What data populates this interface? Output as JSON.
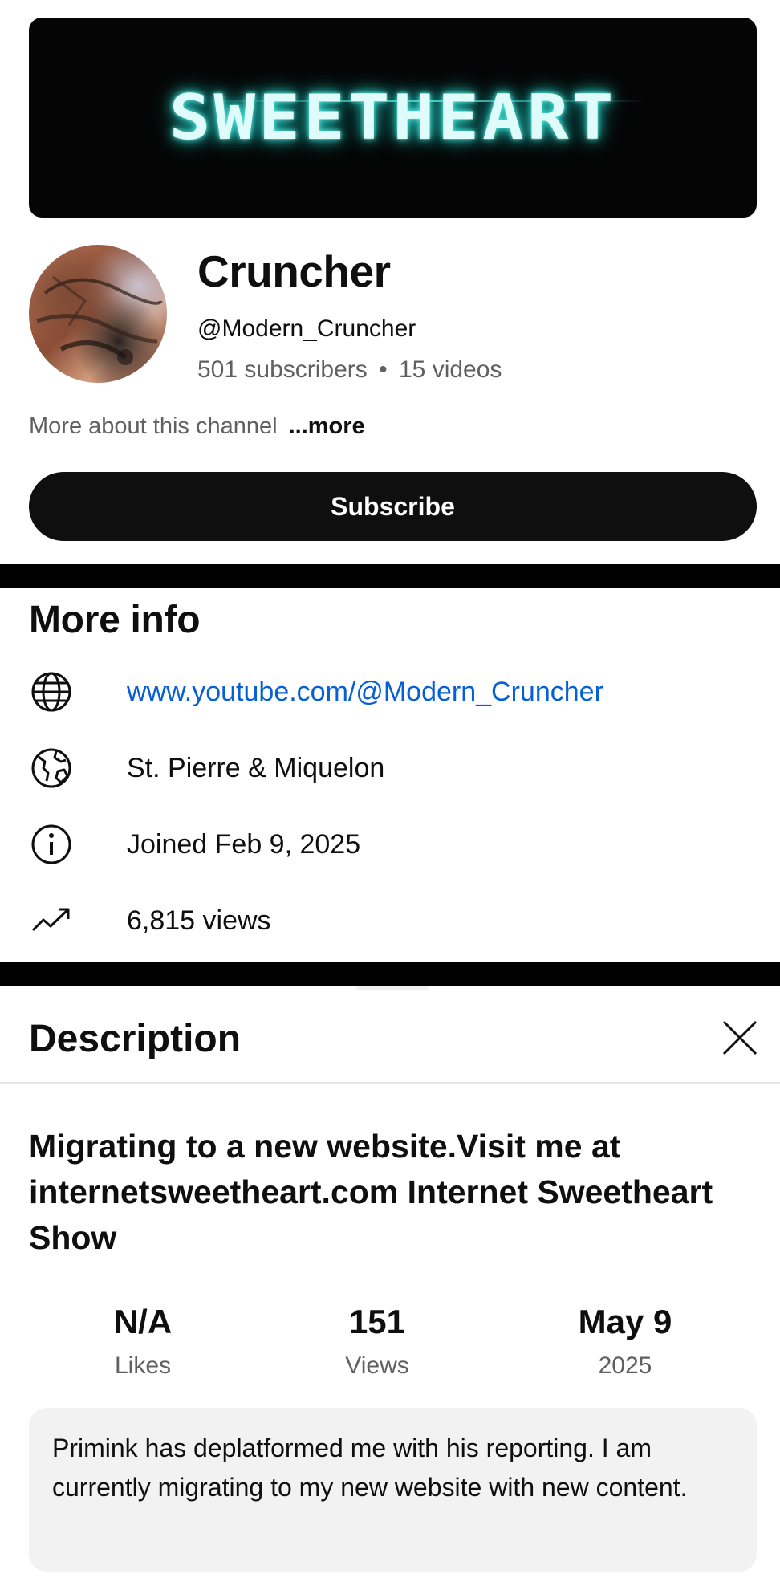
{
  "banner": {
    "text": "SWEETHEART"
  },
  "channel": {
    "name": "Cruncher",
    "handle": "@Modern_Cruncher",
    "subscribers": "501 subscribers",
    "separator": "•",
    "videos": "15 videos",
    "about_text": "More about this channel",
    "more_link": "...more",
    "subscribe_label": "Subscribe"
  },
  "more_info": {
    "title": "More info",
    "items": [
      {
        "icon": "globe-icon",
        "text": "www.youtube.com/@Modern_Cruncher"
      },
      {
        "icon": "earth-icon",
        "text": "St. Pierre & Miquelon"
      },
      {
        "icon": "info-icon",
        "text": "Joined Feb 9, 2025"
      },
      {
        "icon": "trending-icon",
        "text": "6,815 views"
      }
    ]
  },
  "description": {
    "title": "Description",
    "close_icon": "close-icon",
    "video_title": "Migrating to a new website.Visit me at internetsweetheart.com Internet Sweetheart Show",
    "stats": [
      {
        "value": "N/A",
        "label": "Likes"
      },
      {
        "value": "151",
        "label": "Views"
      },
      {
        "value": "May 9",
        "label": "2025"
      }
    ],
    "body": "Primink has deplatformed me with his reporting. I am currently migrating to my new website with new content."
  },
  "colors": {
    "link": "#065fd4",
    "button": "#0f0f0f",
    "divider": "#000000",
    "muted_text": "#606060",
    "banner_glow": "#2ad2c8"
  }
}
